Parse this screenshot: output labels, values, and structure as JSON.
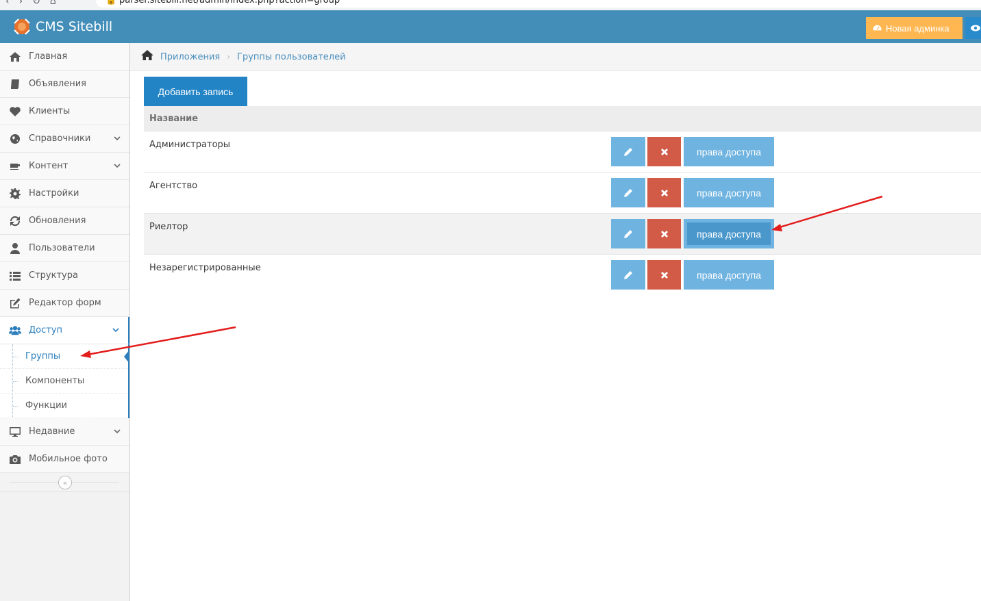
{
  "browser": {
    "url": "parser.sitebill.net/admin/index.php?action=group"
  },
  "header": {
    "brand": "CMS Sitebill",
    "new_admin_label": "Новая админка"
  },
  "sidebar": {
    "items": [
      {
        "label": "Главная",
        "icon": "home-icon"
      },
      {
        "label": "Объявления",
        "icon": "book-icon"
      },
      {
        "label": "Клиенты",
        "icon": "heart-icon"
      },
      {
        "label": "Справочники",
        "icon": "globe-icon"
      },
      {
        "label": "Контент",
        "icon": "coffee-icon"
      },
      {
        "label": "Настройки",
        "icon": "gear-icon"
      },
      {
        "label": "Обновления",
        "icon": "refresh-icon"
      },
      {
        "label": "Пользователи",
        "icon": "user-icon"
      },
      {
        "label": "Структура",
        "icon": "list-icon"
      },
      {
        "label": "Редактор форм",
        "icon": "edit-icon"
      },
      {
        "label": "Доступ",
        "icon": "users-icon"
      }
    ],
    "access_submenu": [
      {
        "label": "Группы"
      },
      {
        "label": "Компоненты"
      },
      {
        "label": "Функции"
      }
    ],
    "items_after": [
      {
        "label": "Недавние",
        "icon": "desktop-icon"
      },
      {
        "label": "Мобильное фото",
        "icon": "camera-icon"
      }
    ]
  },
  "breadcrumbs": {
    "items": [
      "Приложения",
      "Группы пользователей"
    ]
  },
  "main": {
    "add_button": "Добавить запись",
    "table": {
      "header": "Название",
      "rights_label": "права доступа",
      "rows": [
        {
          "name": "Администраторы"
        },
        {
          "name": "Агентство"
        },
        {
          "name": "Риелтор"
        },
        {
          "name": "Незарегистрированные"
        }
      ]
    }
  },
  "colors": {
    "navbar": "#438eb9",
    "accent": "#2b7dbc",
    "edit_button": "#6fb3e0",
    "delete_button": "#d15b47",
    "new_admin_button": "#ffb752",
    "annotation_arrow": "#e31c1c"
  }
}
